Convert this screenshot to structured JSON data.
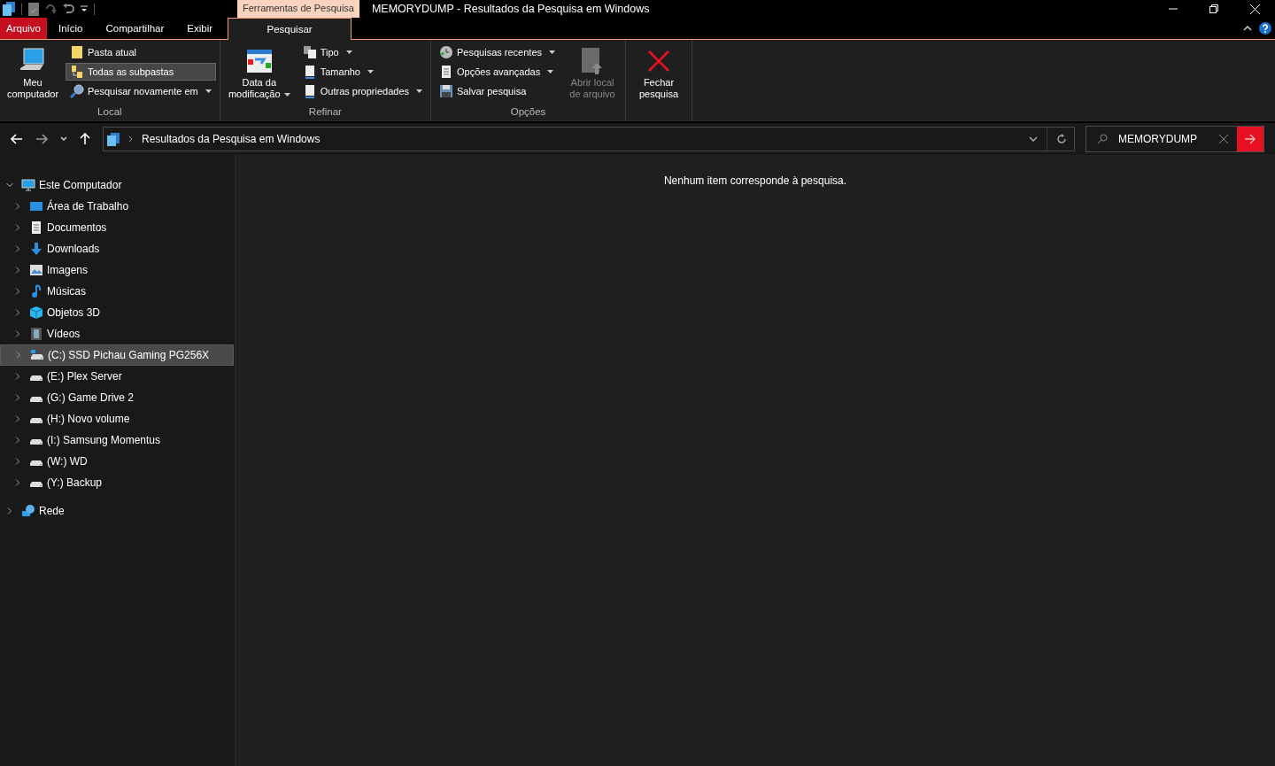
{
  "window": {
    "title": "MEMORYDUMP - Resultados da Pesquisa em Windows",
    "context_tab": "Ferramentas de Pesquisa"
  },
  "tabs": [
    {
      "label": "Arquivo",
      "kind": "file",
      "selected": false
    },
    {
      "label": "Início",
      "kind": "normal",
      "selected": false
    },
    {
      "label": "Compartilhar",
      "kind": "normal",
      "selected": false
    },
    {
      "label": "Exibir",
      "kind": "normal",
      "selected": false
    },
    {
      "label": "Pesquisar",
      "kind": "context",
      "selected": true
    }
  ],
  "ribbon": {
    "groups": [
      {
        "label": "Local",
        "items": [
          {
            "kind": "large",
            "label": "Meu computador",
            "dropdown": false,
            "selected": false
          },
          {
            "kind": "small",
            "label": "Pasta atual",
            "dropdown": false,
            "selected": false
          },
          {
            "kind": "small",
            "label": "Todas as subpastas",
            "dropdown": false,
            "selected": true
          },
          {
            "kind": "small",
            "label": "Pesquisar novamente em",
            "dropdown": true,
            "selected": false
          }
        ]
      },
      {
        "label": "Refinar",
        "items": [
          {
            "kind": "large",
            "label": "Data da modificação",
            "dropdown": true
          },
          {
            "kind": "small",
            "label": "Tipo",
            "dropdown": true
          },
          {
            "kind": "small",
            "label": "Tamanho",
            "dropdown": true
          },
          {
            "kind": "small",
            "label": "Outras propriedades",
            "dropdown": true
          }
        ]
      },
      {
        "label": "Opções",
        "items": [
          {
            "kind": "small",
            "label": "Pesquisas recentes",
            "dropdown": true
          },
          {
            "kind": "small",
            "label": "Opções avançadas",
            "dropdown": true
          },
          {
            "kind": "small",
            "label": "Salvar pesquisa",
            "dropdown": false
          },
          {
            "kind": "large",
            "label": "Abrir local de arquivo",
            "dropdown": false,
            "disabled": true
          }
        ]
      },
      {
        "items": [
          {
            "kind": "large",
            "label": "Fechar pesquisa",
            "dropdown": false,
            "disabled": false
          }
        ]
      }
    ]
  },
  "address": {
    "path": "Resultados da Pesquisa em Windows"
  },
  "search": {
    "value": "MEMORYDUMP"
  },
  "tree": [
    {
      "label": "Este Computador",
      "expanded": true,
      "selected": false,
      "children": [
        {
          "label": "Área de Trabalho",
          "expanded": false,
          "selected": false
        },
        {
          "label": "Documentos",
          "expanded": false,
          "selected": false
        },
        {
          "label": "Downloads",
          "expanded": false,
          "selected": false
        },
        {
          "label": "Imagens",
          "expanded": false,
          "selected": false
        },
        {
          "label": "Músicas",
          "expanded": false,
          "selected": false
        },
        {
          "label": "Objetos 3D",
          "expanded": false,
          "selected": false
        },
        {
          "label": "Vídeos",
          "expanded": false,
          "selected": false
        },
        {
          "label": "(C:) SSD Pichau Gaming PG256X",
          "expanded": false,
          "selected": true
        },
        {
          "label": "(E:) Plex Server",
          "expanded": false,
          "selected": false
        },
        {
          "label": "(G:) Game Drive 2",
          "expanded": false,
          "selected": false
        },
        {
          "label": "(H:) Novo volume",
          "expanded": false,
          "selected": false
        },
        {
          "label": "(I:) Samsung Momentus",
          "expanded": false,
          "selected": false
        },
        {
          "label": "(W:) WD",
          "expanded": false,
          "selected": false
        },
        {
          "label": "(Y:) Backup",
          "expanded": false,
          "selected": false
        }
      ]
    },
    {
      "label": "Rede",
      "expanded": false,
      "selected": false
    }
  ],
  "content": {
    "message": "Nenhum item corresponde à pesquisa."
  }
}
